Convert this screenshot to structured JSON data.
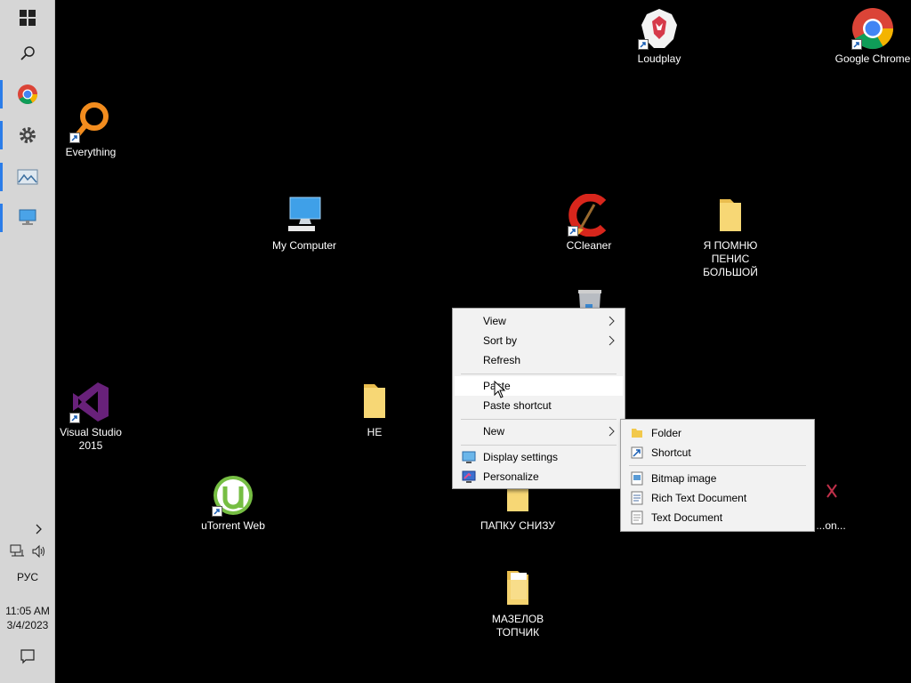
{
  "taskbar": {
    "icons": [
      "windows-start-icon",
      "search-icon",
      "chrome-icon",
      "settings-gear-icon",
      "photos-icon",
      "remote-desktop-icon"
    ],
    "language": "РУС",
    "time": "11:05 AM",
    "date": "3/4/2023"
  },
  "desktop": {
    "icons": [
      {
        "label": "Loudplay"
      },
      {
        "label": "Google Chrome"
      },
      {
        "label": "Everything"
      },
      {
        "label": "My Computer"
      },
      {
        "label": "CCleaner"
      },
      {
        "label": "Я ПОМНЮ ПЕНИС БОЛЬШОЙ"
      },
      {
        "label": "Visual Studio 2015"
      },
      {
        "label": "НЕ"
      },
      {
        "label": "uTorrent Web"
      },
      {
        "label": "ПАПКУ СНИЗУ"
      },
      {
        "label": "МАЗЕЛОВ ТОПЧИК"
      },
      {
        "label": "...on..."
      }
    ]
  },
  "context_menu": {
    "items": [
      "View",
      "Sort by",
      "Refresh",
      "Paste",
      "Paste shortcut",
      "New",
      "Display settings",
      "Personalize"
    ]
  },
  "new_submenu": {
    "items": [
      "Folder",
      "Shortcut",
      "Bitmap image",
      "Rich Text Document",
      "Text Document"
    ]
  },
  "colors": {
    "taskbar_bg": "#d6d6d6",
    "active_indicator": "#2b7de9",
    "menu_bg": "#f2f2f2",
    "desktop_bg": "#000000"
  }
}
